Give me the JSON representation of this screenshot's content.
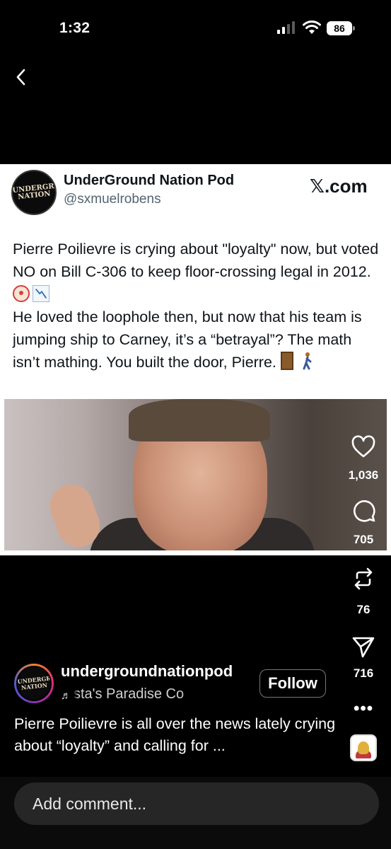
{
  "status_bar": {
    "time": "1:32",
    "battery": "86",
    "icons": [
      "cellular-signal-icon",
      "wifi-icon",
      "battery-icon"
    ]
  },
  "nav": {
    "back_icon": "chevron-left-icon"
  },
  "tweet": {
    "display_name": "UnderGround Nation Pod",
    "handle": "@sxmuelrobens",
    "source": "𝕏.com",
    "avatar_logo": "UNDERGROUND NATION",
    "text_part1": "Pierre Poilievre is crying about \"loyalty\" now, but voted NO on Bill C-306 to keep floor-crossing legal in 2012. ",
    "text_part2": "He loved the loophole then, but now that his team is jumping ship to Carney, it’s a “betrayal”? The math isn’t mathing. You built the door, Pierre. ",
    "emojis": [
      "clown-face",
      "chart-decreasing",
      "door",
      "person-walking"
    ]
  },
  "actions": {
    "likes": "1,036",
    "comments": "705",
    "reposts": "76",
    "shares": "716",
    "icons": [
      "heart-icon",
      "comment-icon",
      "repost-icon",
      "send-icon",
      "more-icon"
    ]
  },
  "post": {
    "username": "undergroundnationpod",
    "audio_track": "sta's Paradise   Co",
    "follow_label": "Follow",
    "caption": "Pierre Poilievre is all over the news lately crying about “loyalty” and calling for ...",
    "more_label": "•••"
  },
  "comment": {
    "placeholder": "Add comment..."
  }
}
